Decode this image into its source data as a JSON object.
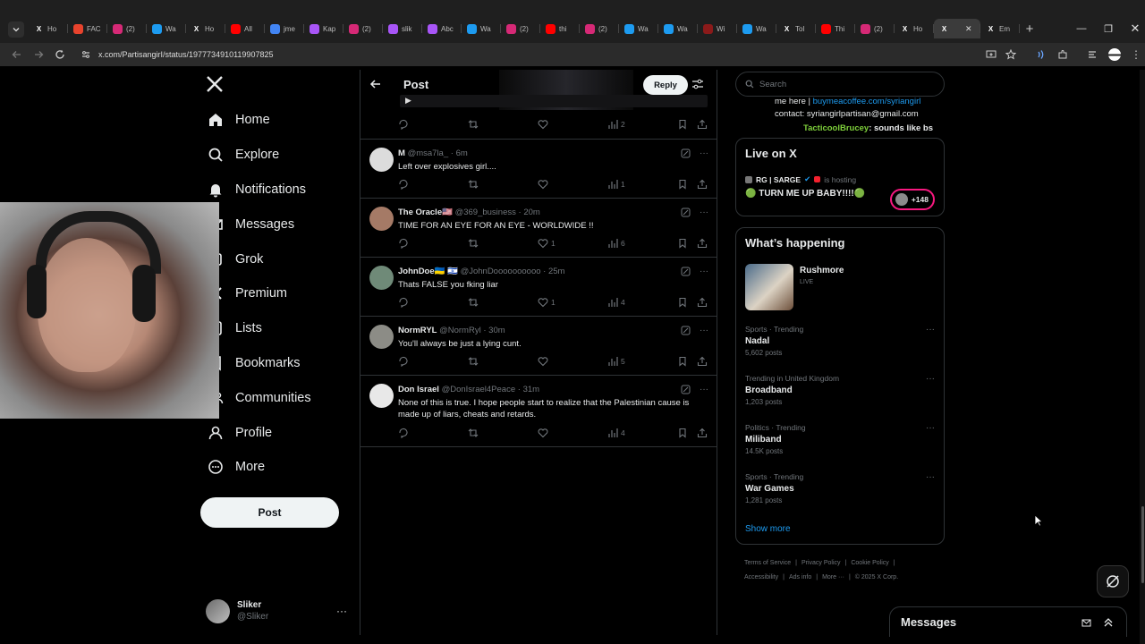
{
  "browser": {
    "tabs": [
      {
        "label": "Ho",
        "icon": "x-icon",
        "color": "#ffffff"
      },
      {
        "label": "FAC",
        "icon": "fac-icon",
        "color": "#e8432d"
      },
      {
        "label": "(2)",
        "icon": "instagram-icon",
        "color": "#d62976"
      },
      {
        "label": "Wa",
        "icon": "web-icon",
        "color": "#1d9bf0"
      },
      {
        "label": "Ho",
        "icon": "x-icon",
        "color": "#ffffff"
      },
      {
        "label": "All",
        "icon": "youtube-icon",
        "color": "#ff0000"
      },
      {
        "label": "jme",
        "icon": "google-icon",
        "color": "#4285f4"
      },
      {
        "label": "Kap",
        "icon": "bookmark-tab-icon",
        "color": "#a855f7"
      },
      {
        "label": "(2)",
        "icon": "instagram-icon",
        "color": "#d62976"
      },
      {
        "label": "slik",
        "icon": "bookmark-tab-icon",
        "color": "#a855f7"
      },
      {
        "label": "Abc",
        "icon": "bookmark-tab-icon",
        "color": "#a855f7"
      },
      {
        "label": "Wa",
        "icon": "web-icon",
        "color": "#1d9bf0"
      },
      {
        "label": "(2)",
        "icon": "instagram-icon",
        "color": "#d62976"
      },
      {
        "label": "thi",
        "icon": "youtube-icon",
        "color": "#ff0000"
      },
      {
        "label": "(2)",
        "icon": "instagram-icon",
        "color": "#d62976"
      },
      {
        "label": "Wa",
        "icon": "web-icon",
        "color": "#1d9bf0"
      },
      {
        "label": "Wa",
        "icon": "web-icon",
        "color": "#1d9bf0"
      },
      {
        "label": "Wi",
        "icon": "wiki-icon",
        "color": "#8b1a1a"
      },
      {
        "label": "Wa",
        "icon": "web-icon",
        "color": "#1d9bf0"
      },
      {
        "label": "Tol",
        "icon": "x-icon",
        "color": "#ffffff"
      },
      {
        "label": "Thi",
        "icon": "youtube-icon",
        "color": "#ff0000"
      },
      {
        "label": "(2)",
        "icon": "instagram-icon",
        "color": "#d62976"
      },
      {
        "label": "Ho",
        "icon": "x-icon",
        "color": "#ffffff"
      }
    ],
    "active_tab": {
      "label": "",
      "icon": "x-icon"
    },
    "after_tab": {
      "label": "Em",
      "icon": "x-icon"
    },
    "url": "x.com/PartisangirI/status/1977734910119907825"
  },
  "left_nav": {
    "items": [
      {
        "label": "Home",
        "icon": "home-icon"
      },
      {
        "label": "Explore",
        "icon": "search-icon"
      },
      {
        "label": "Notifications",
        "icon": "bell-icon"
      },
      {
        "label": "Messages",
        "icon": "mail-icon"
      },
      {
        "label": "Grok",
        "icon": "grok-icon"
      },
      {
        "label": "Premium",
        "icon": "x-icon"
      },
      {
        "label": "Lists",
        "icon": "list-icon"
      },
      {
        "label": "Bookmarks",
        "icon": "bookmark-icon"
      },
      {
        "label": "Communities",
        "icon": "people-icon"
      },
      {
        "label": "Profile",
        "icon": "person-icon"
      },
      {
        "label": "More",
        "icon": "more-circle-icon"
      }
    ],
    "post_label": "Post",
    "account": {
      "name": "Sliker",
      "handle": "@Sliker"
    }
  },
  "post": {
    "title": "Post",
    "reply_label": "Reply",
    "top_stats": {
      "views": "2"
    },
    "replies": [
      {
        "name": "M",
        "handle": "@msa7la_",
        "time": "6m",
        "text": "Left over explosives girl....",
        "likes": "",
        "views": "1",
        "avatar_color": "#dcdcdc"
      },
      {
        "name": "The Oracle🇺🇸",
        "handle": "@369_business",
        "time": "20m",
        "text": "TIME FOR AN EYE FOR AN EYE - WORLDWIDE !!",
        "likes": "1",
        "views": "6",
        "avatar_color": "#a57a66"
      },
      {
        "name": "JohnDoe🇺🇦 🇮🇱",
        "handle": "@JohnDoooooooooo",
        "time": "25m",
        "text": "Thats FALSE you fking liar",
        "likes": "1",
        "views": "4",
        "avatar_color": "#6f8a78"
      },
      {
        "name": "NormRYL",
        "handle": "@NormRyl",
        "time": "30m",
        "text": "You'll always be just a lying cunt.",
        "likes": "",
        "views": "5",
        "avatar_color": "#8c8c86"
      },
      {
        "name": "Don Israel",
        "handle": "@DonIsrael4Peace",
        "time": "31m",
        "text": "None of this is true. I hope people start to realize that the Palestinian cause is made up of liars, cheats and retards.",
        "likes": "",
        "views": "4",
        "avatar_color": "#e8e8e8"
      }
    ]
  },
  "right": {
    "search_placeholder": "Search",
    "bio_line1": "me here |",
    "bio_link": "buymeacoffee.com/syriangirl",
    "bio_line2": "contact: syriangirlpartisan@gmail.com",
    "chat_user": "TacticoolBrucey",
    "chat_text": ": sounds like bs",
    "live": {
      "title": "Live on X",
      "host": "RG | SARGE",
      "host_status": "is hosting",
      "stream_title": "🟢 TURN ME UP BABY!!!!🟢",
      "listeners": "+148"
    },
    "happening": {
      "title": "What’s happening",
      "feature": {
        "name": "Rushmore",
        "status": "LIVE"
      },
      "trends": [
        {
          "meta": "Sports · Trending",
          "name": "Nadal",
          "count": "5,602 posts"
        },
        {
          "meta": "Trending in United Kingdom",
          "name": "Broadband",
          "count": "1,203 posts"
        },
        {
          "meta": "Politics · Trending",
          "name": "Miliband",
          "count": "14.5K posts"
        },
        {
          "meta": "Sports · Trending",
          "name": "War Games",
          "count": "1,281 posts"
        }
      ],
      "show_more": "Show more"
    },
    "footer": {
      "links": [
        "Terms of Service",
        "Privacy Policy",
        "Cookie Policy",
        "Accessibility",
        "Ads info",
        "More ···"
      ],
      "copyright": "© 2025 X Corp."
    }
  },
  "messages_dock": {
    "title": "Messages"
  },
  "colors": {
    "accent": "#1d9bf0",
    "chat_user": "#7fd13b",
    "live_ring": "#f91880",
    "bg": "#000000",
    "border": "#2f3336"
  }
}
